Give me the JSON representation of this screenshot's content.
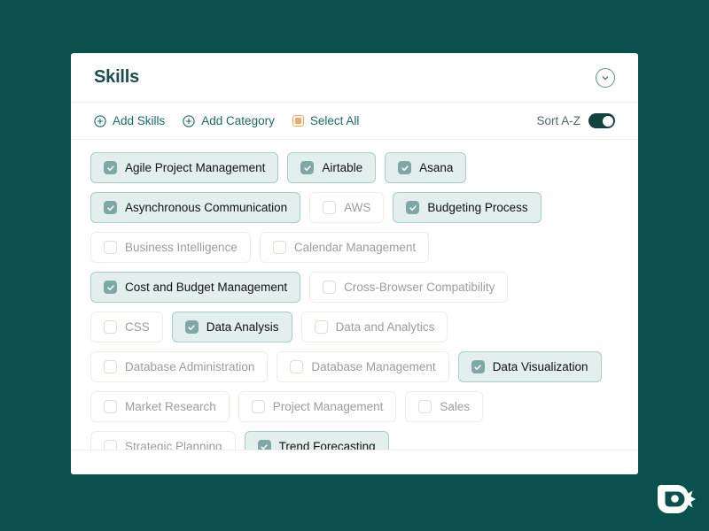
{
  "theme": {
    "page_background": "#0A504C",
    "card_background": "#FFFFFF",
    "title_color": "#1D4E4B",
    "accent_teal": "#1D6A62",
    "checkbox_checked": "#7FA8A4",
    "chip_checked_background": "#E2EFED",
    "chip_checked_border": "#A9CCC8",
    "chip_unchecked_border": "#F2EBE7",
    "chip_unchecked_text": "#9C9C9C",
    "select_all_orange": "#F0A868",
    "toggle_on_color": "#13413E"
  },
  "header": {
    "title": "Skills",
    "collapse_icon": "chevron-down-icon"
  },
  "toolbar": {
    "add_skills_label": "Add Skills",
    "add_skills_icon": "plus-circle-icon",
    "add_category_label": "Add Category",
    "add_category_icon": "plus-circle-icon",
    "select_all_label": "Select All",
    "select_all_icon": "filled-square-checkbox-icon",
    "sort_label": "Sort A-Z",
    "sort_toggle_state": "on"
  },
  "skills_rows": [
    [
      {
        "label": "Agile Project Management",
        "checked": true
      },
      {
        "label": "Airtable",
        "checked": true
      },
      {
        "label": "Asana",
        "checked": true
      }
    ],
    [
      {
        "label": "Asynchronous Communication",
        "checked": true
      },
      {
        "label": "AWS",
        "checked": false
      },
      {
        "label": "Budgeting Process",
        "checked": true
      }
    ],
    [
      {
        "label": "Business Intelligence",
        "checked": false
      },
      {
        "label": "Calendar Management",
        "checked": false
      }
    ],
    [
      {
        "label": "Cost and Budget Management",
        "checked": true
      },
      {
        "label": "Cross-Browser Compatibility",
        "checked": false
      }
    ],
    [
      {
        "label": "CSS",
        "checked": false
      },
      {
        "label": "Data Analysis",
        "checked": true
      },
      {
        "label": "Data and Analytics",
        "checked": false
      }
    ],
    [
      {
        "label": "Database Administration",
        "checked": false
      },
      {
        "label": "Database Management",
        "checked": false
      },
      {
        "label": "Data Visualization",
        "checked": true
      }
    ],
    [
      {
        "label": "Market Research",
        "checked": false
      },
      {
        "label": "Project Management",
        "checked": false
      },
      {
        "label": "Sales",
        "checked": false
      }
    ],
    [
      {
        "label": "Strategic Planning",
        "checked": false
      },
      {
        "label": "Trend Forecasting",
        "checked": true
      }
    ]
  ],
  "brand": {
    "logo_icon": "brand-bird-logo-icon"
  }
}
